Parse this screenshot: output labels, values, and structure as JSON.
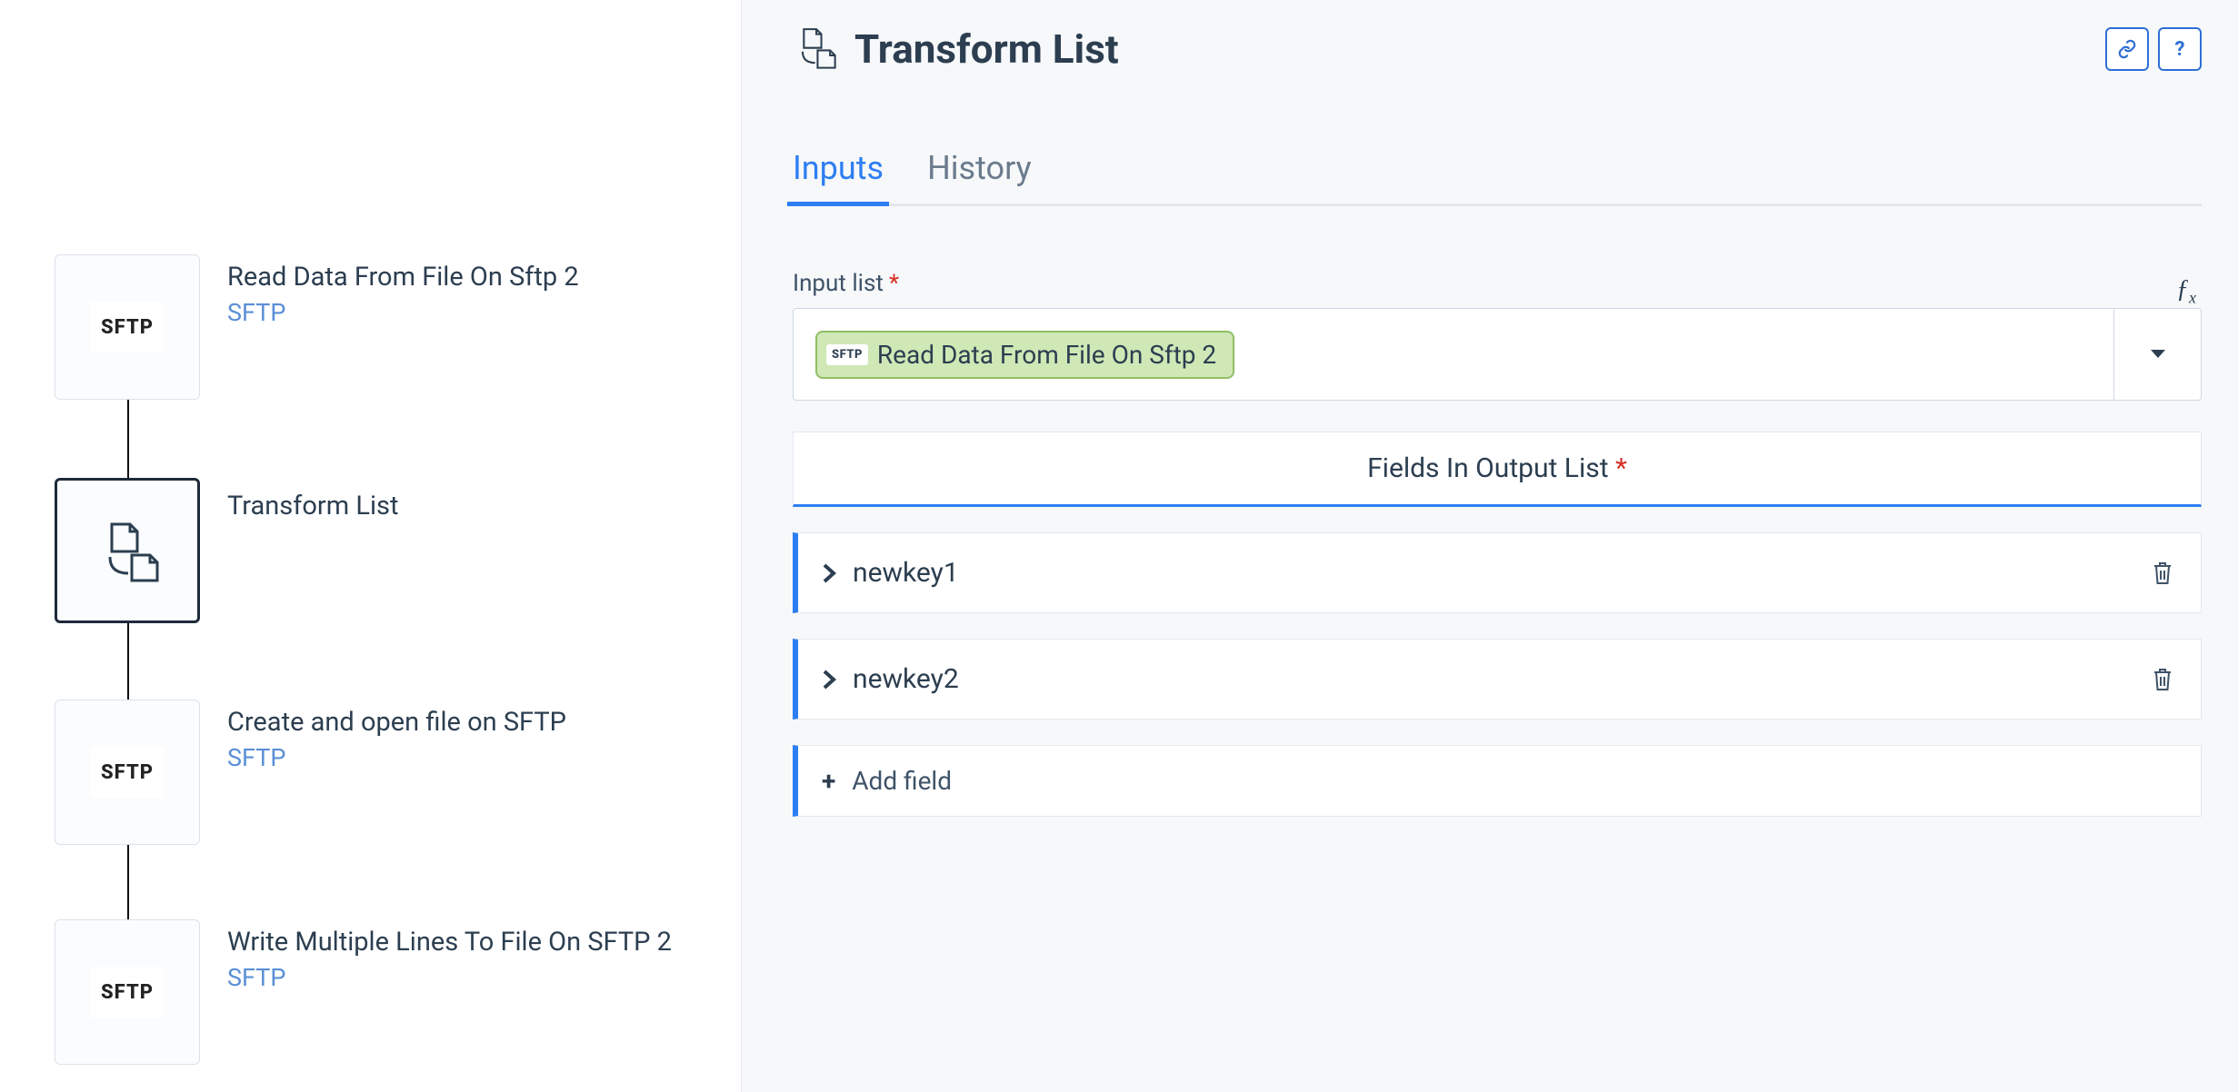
{
  "flow": {
    "nodes": {
      "n0": {
        "title": "Read Data From File On Sftp 2",
        "subtitle": "SFTP",
        "badge": "SFTP"
      },
      "n1": {
        "title": "Transform List"
      },
      "n2": {
        "title": "Create and open file on SFTP",
        "subtitle": "SFTP",
        "badge": "SFTP"
      },
      "n3": {
        "title": "Write Multiple Lines To File On SFTP 2",
        "subtitle": "SFTP",
        "badge": "SFTP"
      }
    }
  },
  "panel": {
    "title": "Transform List",
    "tabs": {
      "inputs": "Inputs",
      "history": "History"
    },
    "input_list": {
      "label": "Input list",
      "chip_badge": "SFTP",
      "chip_text": "Read Data From File On Sftp 2"
    },
    "fields_section_label": "Fields In Output List",
    "fields": {
      "f0": "newkey1",
      "f1": "newkey2"
    },
    "add_field_label": "Add field",
    "actions": {
      "help": "?"
    }
  }
}
